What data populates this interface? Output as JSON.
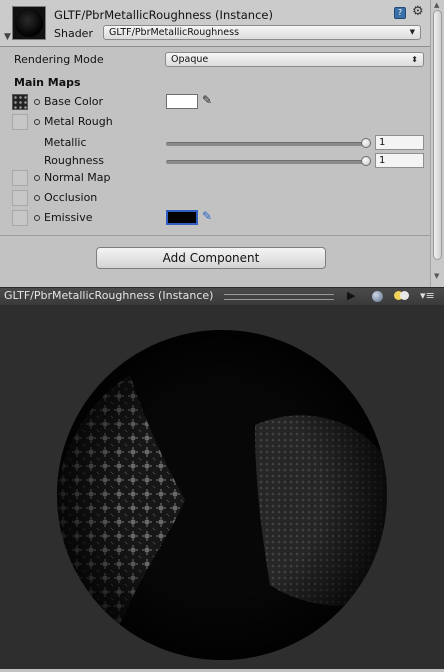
{
  "material": {
    "title": "GLTF/PbrMetallicRoughness (Instance)",
    "shader_label": "Shader",
    "shader_value": "GLTF/PbrMetallicRoughness"
  },
  "rendering": {
    "label": "Rendering Mode",
    "value": "Opaque"
  },
  "main_maps": {
    "header": "Main Maps",
    "base_color": "Base Color",
    "metal_rough": "Metal Rough",
    "metallic": {
      "label": "Metallic",
      "value": "1",
      "level": 1.0
    },
    "roughness": {
      "label": "Roughness",
      "value": "1",
      "level": 1.0
    },
    "normal_map": "Normal Map",
    "occlusion": "Occlusion",
    "emissive": "Emissive",
    "colors": {
      "base": "#ffffff",
      "emissive": "#000000"
    }
  },
  "add_component": "Add Component",
  "preview": {
    "title": "GLTF/PbrMetallicRoughness (Instance)"
  }
}
